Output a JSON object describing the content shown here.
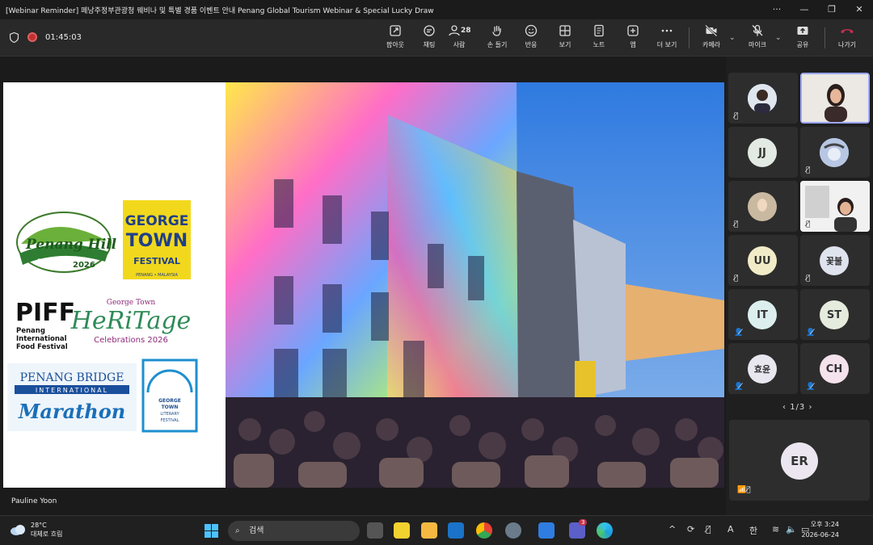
{
  "window": {
    "title": "[Webinar Reminder] 페낭주정부관광청 웨비나 및 특별 경품 이벤트 안내 Penang Global Tourism Webinar & Special Lucky Draw",
    "more": "···",
    "minimize": "—",
    "restore": "❐",
    "close": "✕"
  },
  "toolbar": {
    "timer": "01:45:03",
    "people_count": "28",
    "buttons": [
      {
        "label": "팝아웃"
      },
      {
        "label": "채팅"
      },
      {
        "label": "사람"
      },
      {
        "label": "손 들기"
      },
      {
        "label": "반응"
      },
      {
        "label": "보기"
      },
      {
        "label": "노트"
      },
      {
        "label": "앱"
      },
      {
        "label": "더 보기"
      }
    ],
    "camera_label": "카메라",
    "mic_label": "마이크",
    "share_label": "공유",
    "leave_label": "나가기"
  },
  "stage": {
    "speaker_name": "Pauline Yoon"
  },
  "participants": {
    "tiles": [
      {
        "initials": "",
        "kind": "video"
      },
      {
        "initials": "",
        "kind": "video"
      },
      {
        "initials": "JJ",
        "kind": "avatar",
        "color": "#e3e9e3"
      },
      {
        "initials": "",
        "kind": "photo"
      },
      {
        "initials": "",
        "kind": "photo"
      },
      {
        "initials": "",
        "kind": "video"
      },
      {
        "initials": "UU",
        "kind": "avatar",
        "color": "#f1ecc7"
      },
      {
        "initials": "꽃불",
        "kind": "avatar",
        "color": "#dfe3ee"
      },
      {
        "initials": "IT",
        "kind": "avatar",
        "color": "#dcefee"
      },
      {
        "initials": "ST",
        "kind": "avatar",
        "color": "#e5ecdd"
      },
      {
        "initials": "효윤",
        "kind": "avatar",
        "color": "#e8e6ef"
      },
      {
        "initials": "CH",
        "kind": "avatar",
        "color": "#f4e2ec"
      }
    ],
    "pager": "1/3",
    "big_tile_initials": "ER"
  },
  "taskbar": {
    "temperature": "28°C",
    "weather_text": "대체로 흐림",
    "search_placeholder": "검색",
    "teams_badge": "3",
    "ime": "A",
    "lang": "한",
    "time": "오후 3:24",
    "date": "2026-06-24"
  },
  "colors": {
    "accent": "#9aa7ff",
    "recording": "#c13131",
    "leave": "#c4314b"
  }
}
